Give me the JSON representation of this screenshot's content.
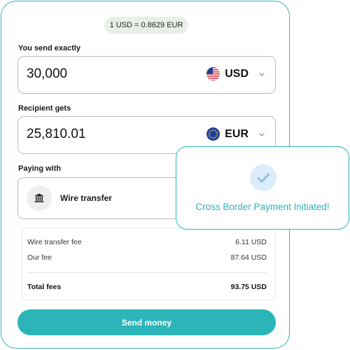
{
  "rate": {
    "text": "1 USD = 0.8629 EUR"
  },
  "send": {
    "label": "You send exactly",
    "amount": "30,000",
    "currency": "USD",
    "flag_icon": "us-flag-icon"
  },
  "receive": {
    "label": "Recipient gets",
    "amount": "25,810.01",
    "currency": "EUR",
    "flag_icon": "eu-flag-icon"
  },
  "paying": {
    "label": "Paying with",
    "method": "Wire transfer",
    "method_icon": "bank-icon"
  },
  "fees": {
    "rows": [
      {
        "label": "Wire transfer fee",
        "value": "6.11 USD"
      },
      {
        "label": "Our fee",
        "value": "87.64 USD"
      }
    ],
    "total": {
      "label": "Total fees",
      "value": "93.75 USD"
    }
  },
  "action": {
    "send_label": "Send money"
  },
  "toast": {
    "message": "Cross Border Payment Initiated!",
    "icon": "check-icon"
  },
  "colors": {
    "accent": "#2cb5b9",
    "pill": "#e9efe7",
    "check_bg": "#dcecf8",
    "check_mark": "#8cc2e6"
  }
}
